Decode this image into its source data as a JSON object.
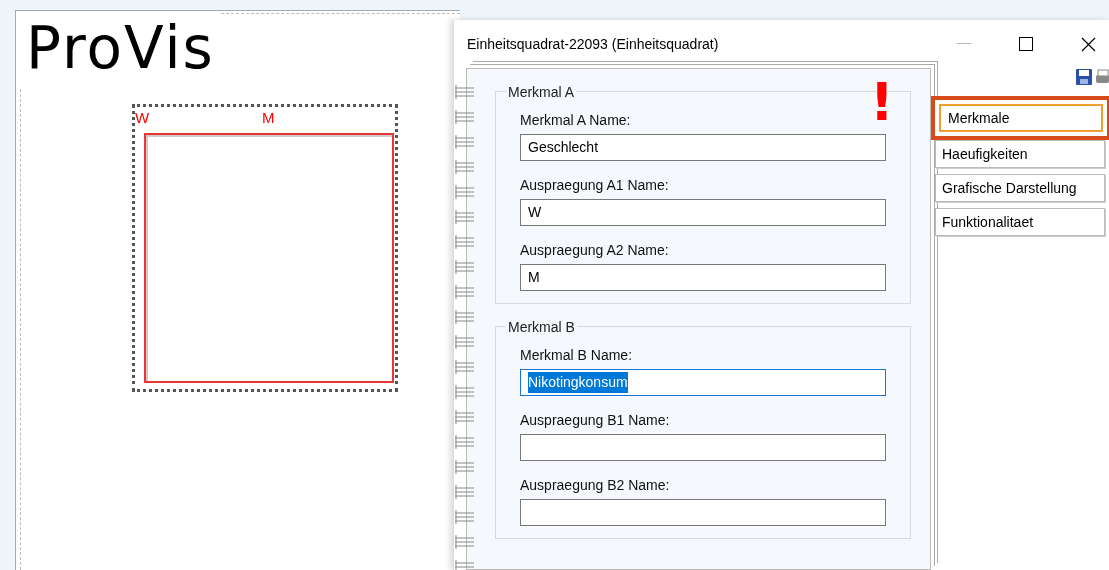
{
  "canvas": {
    "logo": "ProVis",
    "square_labels": [
      "W",
      "M"
    ]
  },
  "window": {
    "title": "Einheitsquadrat-22093 (Einheitsquadrat)"
  },
  "groups": [
    {
      "title": "Merkmal A",
      "fields": [
        {
          "label": "Merkmal A Name:",
          "value": "Geschlecht",
          "focused": false
        },
        {
          "label": "Auspraegung A1 Name:",
          "value": "W",
          "focused": false
        },
        {
          "label": "Auspraegung A2 Name:",
          "value": "M",
          "focused": false
        }
      ]
    },
    {
      "title": "Merkmal B",
      "fields": [
        {
          "label": "Merkmal B Name:",
          "value": "Nikotingkonsum",
          "focused": true
        },
        {
          "label": "Auspraegung B1 Name:",
          "focused": false
        },
        {
          "label": "Auspraegung B2 Name:",
          "focused": false
        }
      ]
    }
  ],
  "tabs": [
    {
      "label": "Merkmale",
      "selected": true
    },
    {
      "label": "Haeufigkeiten",
      "selected": false
    },
    {
      "label": "Grafische Darstellung",
      "selected": false
    },
    {
      "label": "Funktionalitaet",
      "selected": false
    }
  ],
  "annotation": {
    "mark": "!"
  }
}
